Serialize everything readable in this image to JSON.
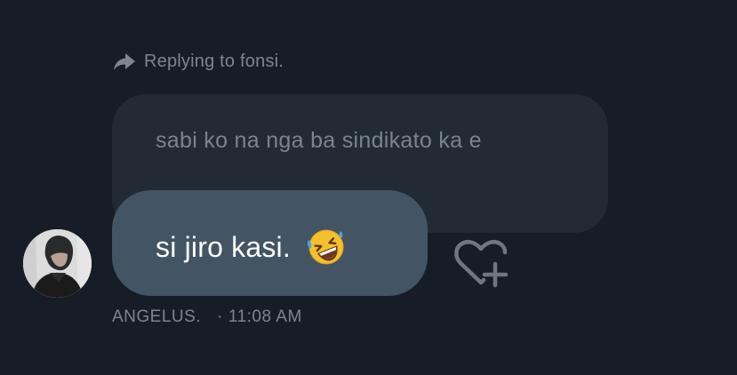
{
  "reply_header": {
    "icon": "reply-arrow-icon",
    "text": "Replying to fonsi."
  },
  "quoted_message": {
    "text": "sabi ko na nga ba sindikato ka e"
  },
  "message": {
    "text": "si jiro kasi.",
    "emoji": "rolling-on-the-floor-laughing-emoji"
  },
  "sender": {
    "avatar": "avatar-photo",
    "name": "ANGELUS.",
    "separator": "·",
    "time": "11:08 AM"
  },
  "actions": {
    "react_icon": "heart-plus-icon"
  },
  "colors": {
    "background": "#161d26",
    "quoted_bubble": "#222a34",
    "message_bubble": "#435464",
    "muted_text": "#7d8590"
  }
}
